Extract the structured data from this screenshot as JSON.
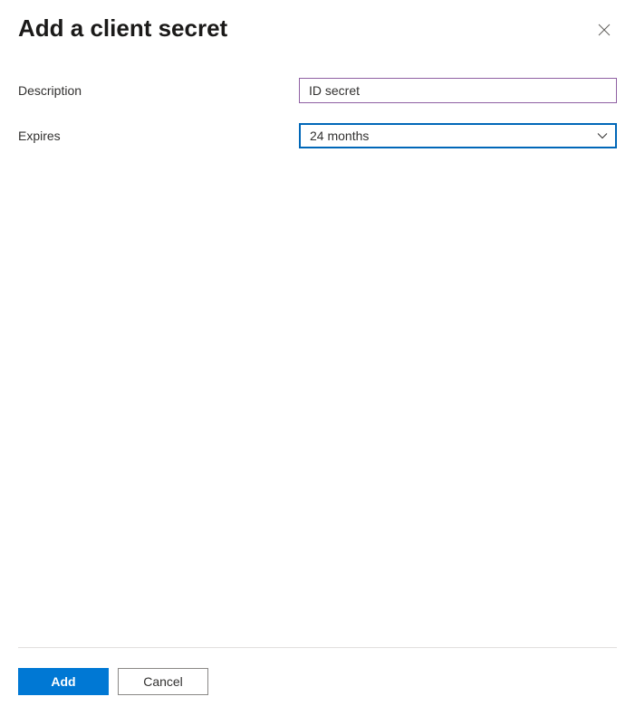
{
  "header": {
    "title": "Add a client secret"
  },
  "form": {
    "description": {
      "label": "Description",
      "value": "ID secret"
    },
    "expires": {
      "label": "Expires",
      "value": "24 months"
    }
  },
  "footer": {
    "add_label": "Add",
    "cancel_label": "Cancel"
  }
}
